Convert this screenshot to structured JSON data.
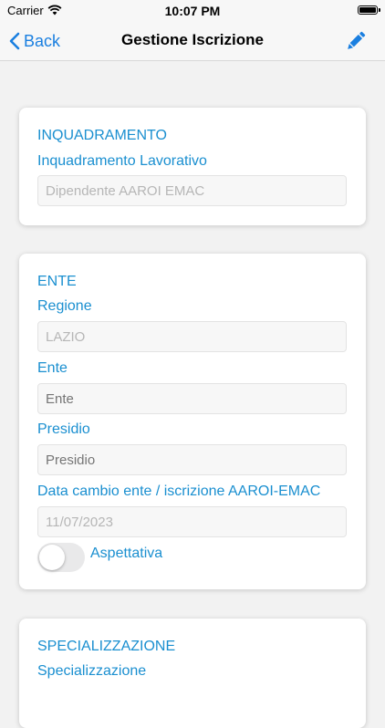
{
  "status_bar": {
    "carrier": "Carrier",
    "time": "10:07 PM"
  },
  "nav": {
    "back_label": "Back",
    "title": "Gestione Iscrizione"
  },
  "inquadramento": {
    "section_title": "INQUADRAMENTO",
    "label": "Inquadramento Lavorativo",
    "value": "Dipendente AAROI EMAC"
  },
  "ente_section": {
    "section_title": "ENTE",
    "regione_label": "Regione",
    "regione_value": "LAZIO",
    "ente_label": "Ente",
    "ente_placeholder": "Ente",
    "presidio_label": "Presidio",
    "presidio_placeholder": "Presidio",
    "data_label": "Data cambio ente / iscrizione AAROI-EMAC",
    "data_value": "11/07/2023",
    "aspettativa_label": "Aspettativa",
    "aspettativa_on": false
  },
  "specializzazione": {
    "section_title": "SPECIALIZZAZIONE",
    "label": "Specializzazione"
  },
  "colors": {
    "accent": "#1a8fd0",
    "link": "#1a7fe0"
  }
}
